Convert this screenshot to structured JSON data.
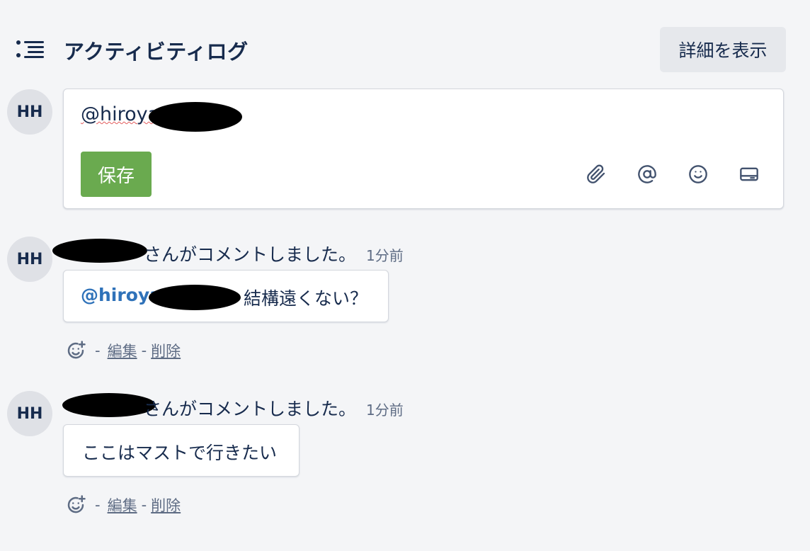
{
  "header": {
    "title": "アクティビティログ",
    "details_button": "詳細を表示",
    "icon": "list-icon"
  },
  "composer": {
    "avatar": "HH",
    "text": "@hiroya",
    "save_label": "保存",
    "tools": [
      "paperclip-icon",
      "at-icon",
      "emoji-icon",
      "card-icon"
    ]
  },
  "comments": [
    {
      "avatar": "HH",
      "action_text": "さんがコメントしました。",
      "time": "1分前",
      "mention": "@hiroya",
      "body": "結構遠くない？",
      "edit_label": "編集",
      "delete_label": "削除",
      "separator": "-"
    },
    {
      "avatar": "HH",
      "action_text": "さんがコメントしました。",
      "time": "1分前",
      "body": "ここはマストで行きたい",
      "edit_label": "編集",
      "delete_label": "削除",
      "separator": "-"
    }
  ],
  "colors": {
    "background": "#f4f5f7",
    "save_button": "#6aaa4f",
    "mention": "#2f72b9",
    "text": "#172b4d",
    "muted": "#5e6c84"
  }
}
